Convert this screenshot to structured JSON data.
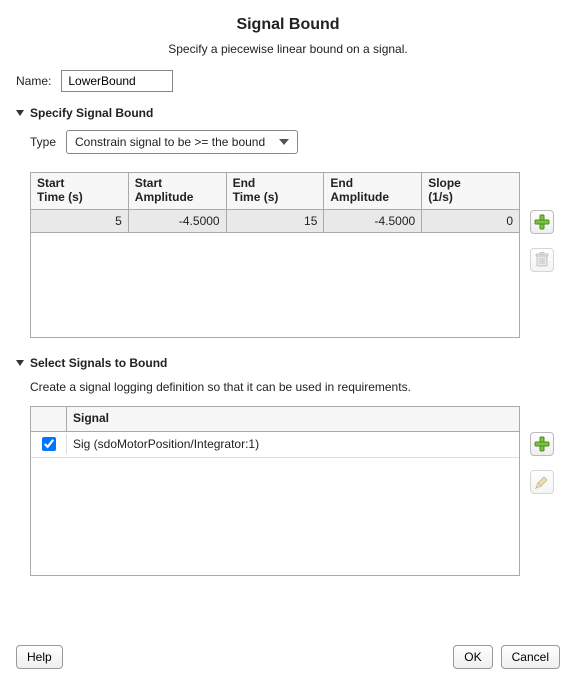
{
  "dialog": {
    "title": "Signal Bound",
    "subtitle": "Specify a piecewise linear bound on a signal."
  },
  "name": {
    "label": "Name:",
    "value": "LowerBound"
  },
  "specify": {
    "section_title": "Specify Signal Bound",
    "type_label": "Type",
    "type_value": "Constrain signal to be >= the bound",
    "columns": {
      "c1a": "Start",
      "c1b": "Time (s)",
      "c2a": "Start",
      "c2b": "Amplitude",
      "c3a": "End",
      "c3b": "Time (s)",
      "c4a": "End",
      "c4b": "Amplitude",
      "c5a": "Slope",
      "c5b": "(1/s)"
    },
    "rows": [
      {
        "start_time": "5",
        "start_amp": "-4.5000",
        "end_time": "15",
        "end_amp": "-4.5000",
        "slope": "0"
      }
    ]
  },
  "select_signals": {
    "section_title": "Select Signals to Bound",
    "helper": "Create a signal logging definition so that it can be used in requirements.",
    "signal_header": "Signal",
    "rows": [
      {
        "checked": true,
        "label": "Sig (sdoMotorPosition/Integrator:1)"
      }
    ]
  },
  "buttons": {
    "help": "Help",
    "ok": "OK",
    "cancel": "Cancel"
  }
}
